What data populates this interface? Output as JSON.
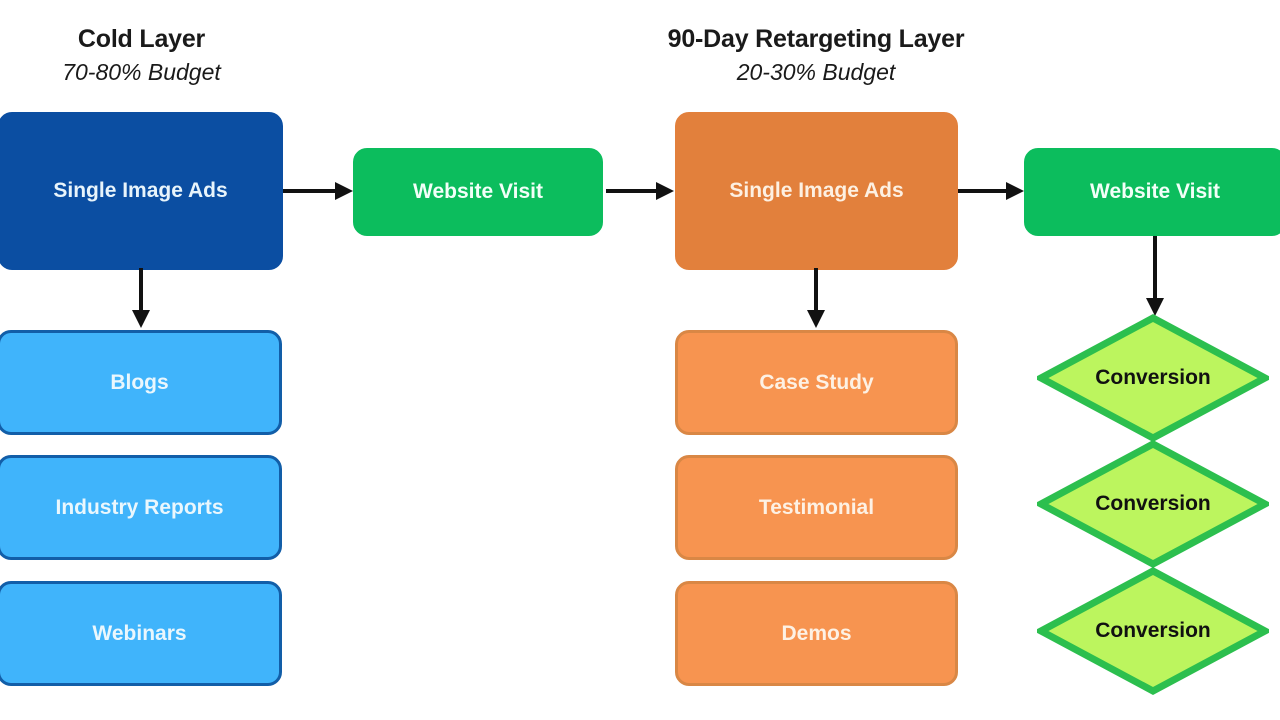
{
  "diagram": {
    "title": "Cold Layer / 90-Day Retargeting Layer funnel",
    "background_color": "#ffffff",
    "arrow_color": "#111111"
  },
  "columns": [
    {
      "id": "cold-layer",
      "title": "Cold Layer",
      "subtitle": "70-80% Budget"
    },
    {
      "id": "retargeting-layer",
      "title": "90-Day Retargeting Layer",
      "subtitle": "20-30% Budget"
    }
  ],
  "nodes": {
    "cold_ads": {
      "label": "Single Image Ads",
      "fill": "#0b4ea2",
      "text_color": "#e8f4fb",
      "shape": "rounded-rect"
    },
    "cold_website_visit": {
      "label": "Website Visit",
      "fill": "#0cbd5d",
      "text_color": "#f2fff8",
      "shape": "rounded-rect"
    },
    "cold_assets": [
      {
        "label": "Blogs",
        "fill": "#40b4fb",
        "border": "#125ea8",
        "text_color": "#eaf7fd"
      },
      {
        "label": "Industry Reports",
        "fill": "#40b4fb",
        "border": "#125ea8",
        "text_color": "#eaf7fd"
      },
      {
        "label": "Webinars",
        "fill": "#40b4fb",
        "border": "#125ea8",
        "text_color": "#eaf7fd"
      }
    ],
    "retarget_ads": {
      "label": "Single Image Ads",
      "fill": "#e2803c",
      "text_color": "#fdf0e2",
      "shape": "rounded-rect"
    },
    "retarget_website_visit": {
      "label": "Website Visit",
      "fill": "#0cbd5d",
      "text_color": "#f2fff8",
      "shape": "rounded-rect"
    },
    "retarget_assets": [
      {
        "label": "Case Study",
        "fill": "#f79450",
        "border": "#d98745",
        "text_color": "#fdf1e4"
      },
      {
        "label": "Testimonial",
        "fill": "#f79450",
        "border": "#d98745",
        "text_color": "#fdf1e4"
      },
      {
        "label": "Demos",
        "fill": "#f79450",
        "border": "#d98745",
        "text_color": "#fdf1e4"
      }
    ],
    "conversions": [
      {
        "label": "Conversion",
        "fill": "#bcf55e",
        "border": "#2cbf4e",
        "text_color": "#111111",
        "shape": "diamond"
      },
      {
        "label": "Conversion",
        "fill": "#bcf55e",
        "border": "#2cbf4e",
        "text_color": "#111111",
        "shape": "diamond"
      },
      {
        "label": "Conversion",
        "fill": "#bcf55e",
        "border": "#2cbf4e",
        "text_color": "#111111",
        "shape": "diamond"
      }
    ]
  },
  "edges": [
    {
      "id": "cold-ads-to-visit",
      "from": "cold_ads",
      "to": "cold_website_visit",
      "direction": "right"
    },
    {
      "id": "cold-ads-to-blogs",
      "from": "cold_ads",
      "to": "cold_assets.0",
      "direction": "down"
    },
    {
      "id": "cold-visit-to-retarget-ads",
      "from": "cold_website_visit",
      "to": "retarget_ads",
      "direction": "right"
    },
    {
      "id": "retarget-ads-to-case-study",
      "from": "retarget_ads",
      "to": "retarget_assets.0",
      "direction": "down"
    },
    {
      "id": "retarget-ads-to-visit",
      "from": "retarget_ads",
      "to": "retarget_website_visit",
      "direction": "right"
    },
    {
      "id": "retarget-visit-to-conversion",
      "from": "retarget_website_visit",
      "to": "conversions.0",
      "direction": "down"
    }
  ]
}
